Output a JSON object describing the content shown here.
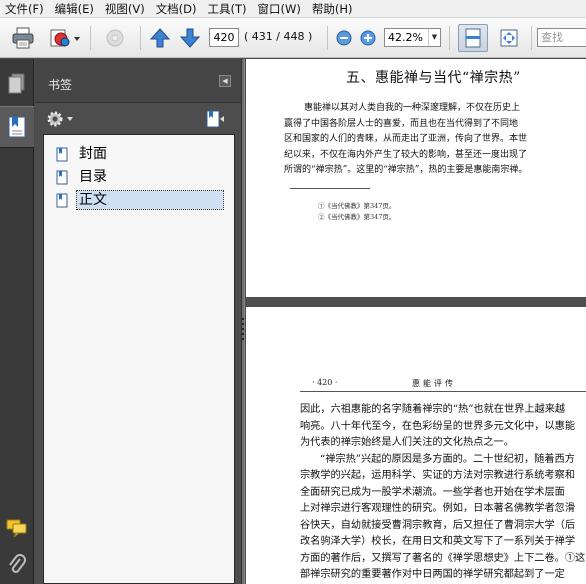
{
  "menu": [
    "文件(F)",
    "编辑(E)",
    "视图(V)",
    "文档(D)",
    "工具(T)",
    "窗口(W)",
    "帮助(H)"
  ],
  "toolbar": {
    "page_current": "420",
    "page_count": "( 431 / 448 )",
    "zoom": "42.2%",
    "search_placeholder": "查找"
  },
  "panel": {
    "title": "书签",
    "bookmarks": [
      "封面",
      "目录",
      "正文"
    ],
    "selected": "正文"
  },
  "page1": {
    "title": "五、惠能禅与当代“禅宗热”",
    "lines": [
      "惠能禅以其对人类自我的一种深邃理解，不仅在历史上",
      "赢得了中国各阶层人士的喜爱，而且也在当代得到了不同地",
      "区和国家的人们的青睐，从而走出了亚洲，传向了世界。本世",
      "纪以来，不仅在海内外产生了较大的影响，甚至还一度出现了",
      "所谓的“禅宗热”。这里的“禅宗热”，热的主要是惠能南宗禅。"
    ],
    "footnotes": [
      "①《当代佛教》第347页。",
      "②《当代佛教》第347页。"
    ]
  },
  "page2": {
    "page_number": "· 420 ·",
    "running_title": "惠能评传",
    "lines": [
      "因此，六祖惠能的名字随着禅宗的“热”也就在世界上越来越",
      "响亮。八十年代至今，在色彩纷呈的世界多元文化中，以惠能",
      "为代表的禅宗始终是人们关注的文化热点之一。",
      "“禅宗热”兴起的原因是多方面的。二十世纪初，随着西方",
      "宗教学的兴起，运用科学、实证的方法对宗教进行系统考察和",
      "全面研究已成为一股学术潮流。一些学者也开始在学术层面",
      "上对禅宗进行客观理性的研究。例如，日本著名佛教学者忽滑",
      "谷快天，自幼就接受曹洞宗教育，后又担任了曹洞宗大学（后",
      "改名驹泽大学）校长，在用日文和英文写下了一系列关于禅学",
      "方面的著作后，又撰写了著名的《禅学思想史》上下二卷。①这",
      "部禅宗研究的重要著作对中日两国的禅学研究都起到了一定"
    ]
  }
}
